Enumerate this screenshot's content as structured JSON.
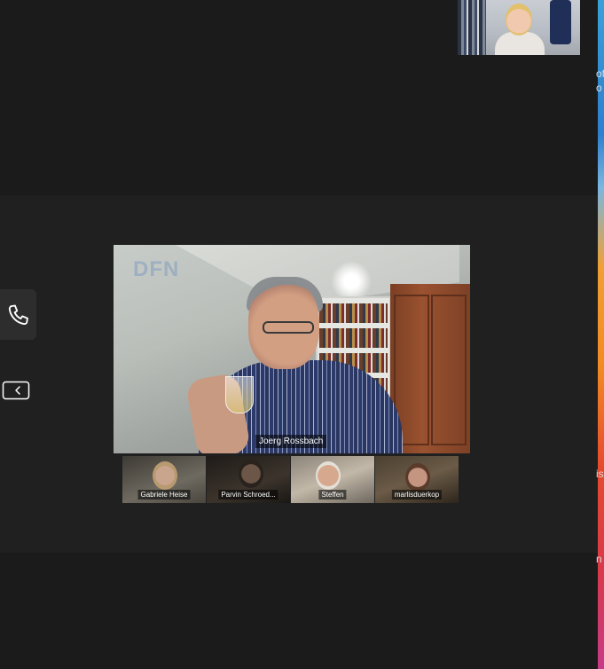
{
  "main_speaker": {
    "name": "Joerg Rossbach",
    "watermark": "DFN"
  },
  "gallery": [
    {
      "name": "Gabriele Heise"
    },
    {
      "name": "Parvin Schroed..."
    },
    {
      "name": "Steffen"
    },
    {
      "name": "marlisduerkop"
    }
  ],
  "right_edge_fragments": [
    "of",
    "o",
    "is",
    "n"
  ],
  "icons": {
    "phone": "phone-icon",
    "collapse": "collapse-panel-icon"
  },
  "colors": {
    "background": "#1b1b1c",
    "panel": "#202021"
  }
}
